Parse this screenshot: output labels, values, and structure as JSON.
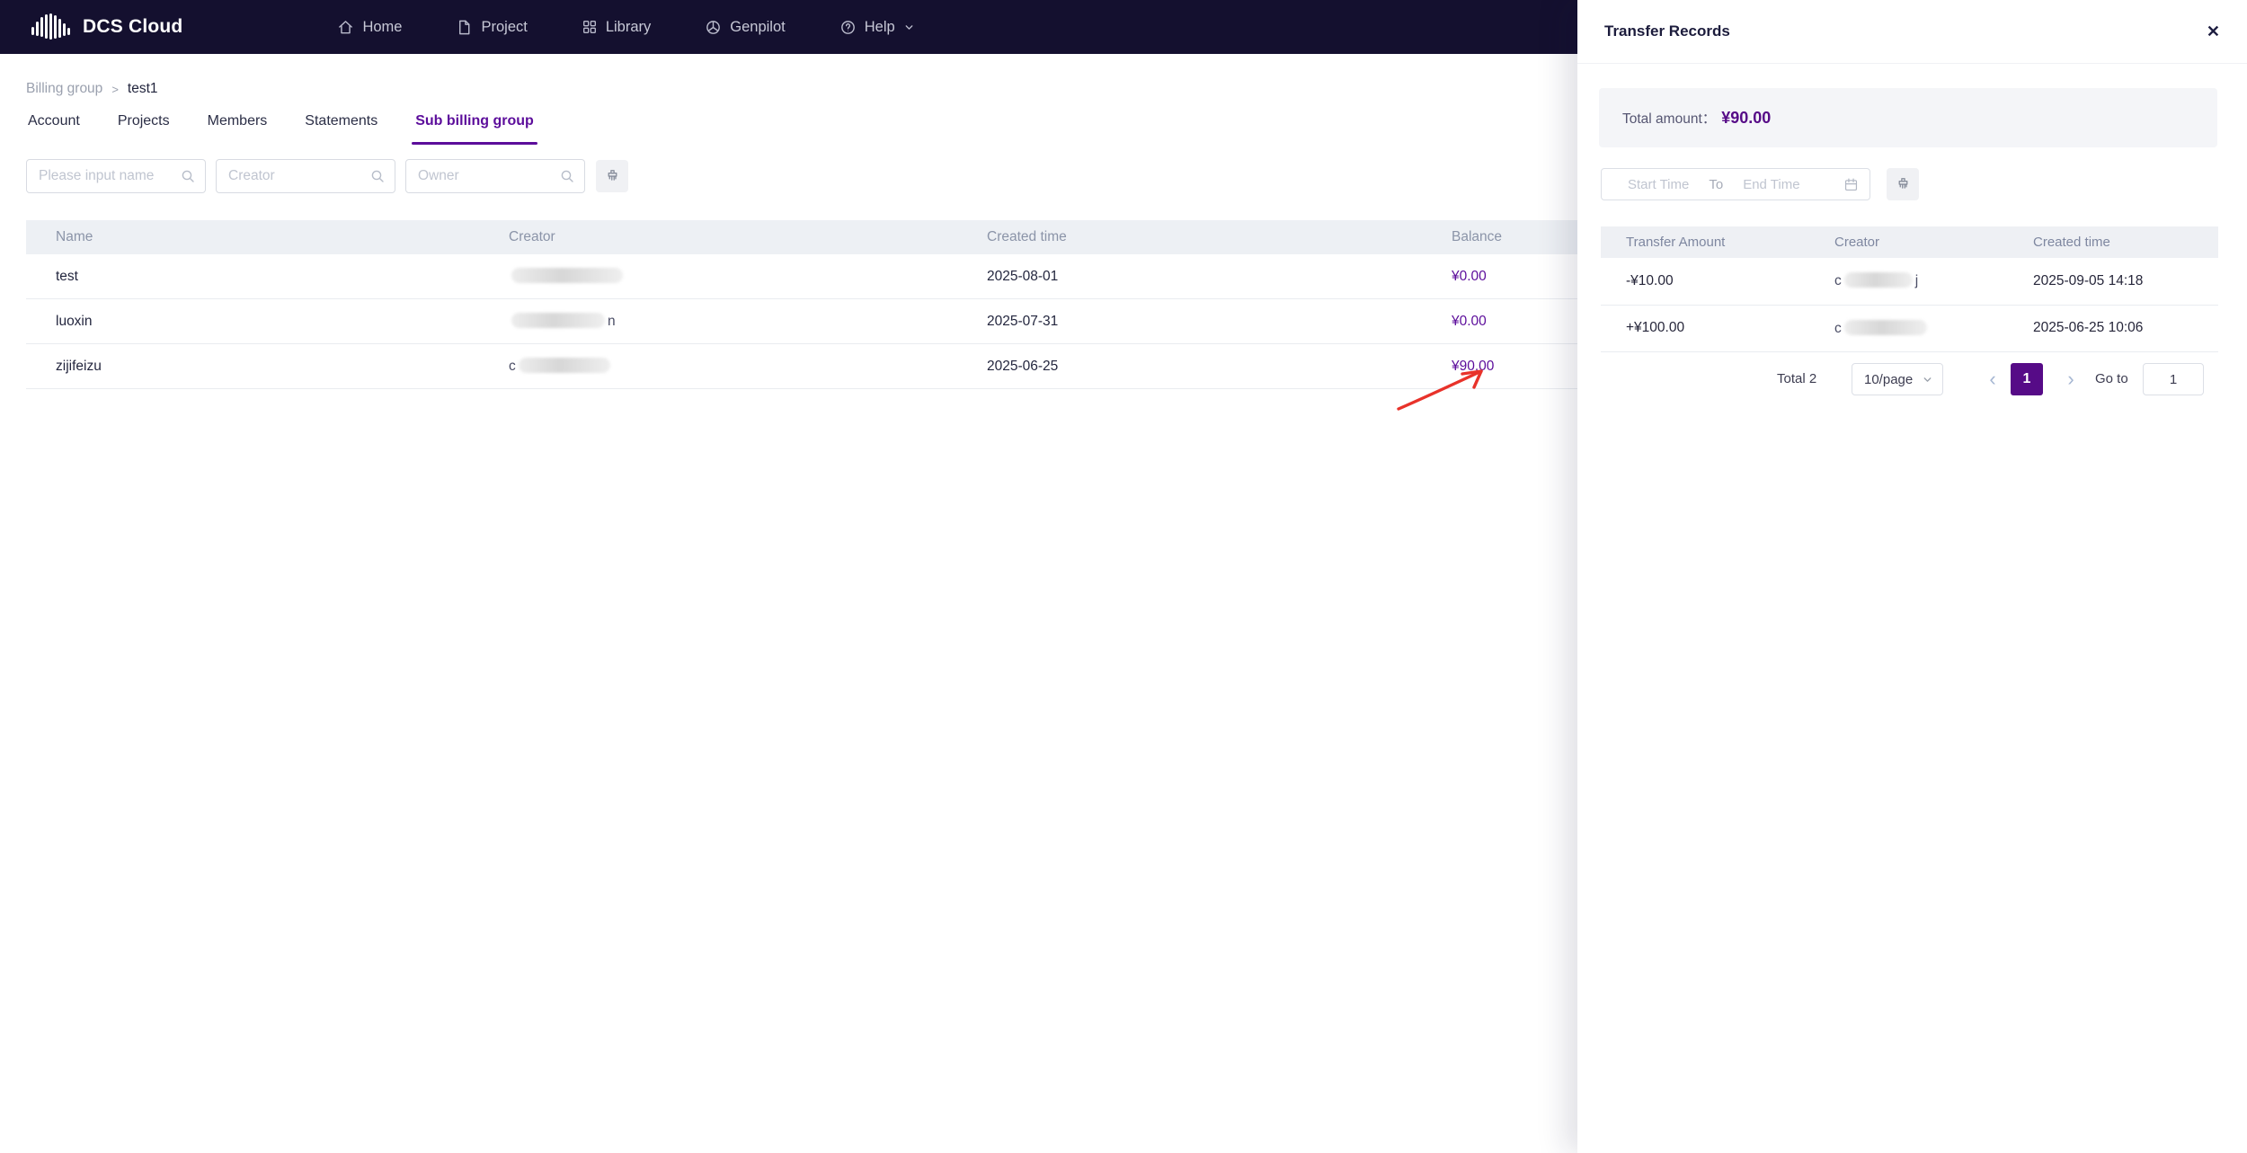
{
  "navbar": {
    "brand": "DCS Cloud",
    "items": [
      {
        "label": "Home",
        "icon": "home-icon"
      },
      {
        "label": "Project",
        "icon": "project-icon"
      },
      {
        "label": "Library",
        "icon": "library-icon"
      },
      {
        "label": "Genpilot",
        "icon": "genpilot-icon"
      },
      {
        "label": "Help",
        "icon": "help-icon",
        "has_dropdown": true
      }
    ]
  },
  "breadcrumb": {
    "parent": "Billing group",
    "separator": ">",
    "current": "test1"
  },
  "tabs": {
    "items": [
      {
        "label": "Account"
      },
      {
        "label": "Projects"
      },
      {
        "label": "Members"
      },
      {
        "label": "Statements"
      },
      {
        "label": "Sub billing group",
        "active": true
      }
    ]
  },
  "filters": {
    "name_placeholder": "Please input name",
    "creator_placeholder": "Creator",
    "owner_placeholder": "Owner"
  },
  "table": {
    "columns": {
      "name": "Name",
      "creator": "Creator",
      "created": "Created time",
      "balance": "Balance"
    },
    "rows": [
      {
        "name": "test",
        "creator_prefix": "",
        "creator_suffix": "",
        "created": "2025-08-01",
        "balance": "¥0.00"
      },
      {
        "name": "luoxin",
        "creator_prefix": "",
        "creator_suffix": "n",
        "created": "2025-07-31",
        "balance": "¥0.00"
      },
      {
        "name": "zijifeizu",
        "creator_prefix": "c",
        "creator_suffix": "",
        "created": "2025-06-25",
        "balance": "¥90.00"
      }
    ]
  },
  "drawer": {
    "title": "Transfer Records",
    "close_glyph": "✕",
    "total_label": "Total amount：",
    "total_value": "¥90.00",
    "date_filter": {
      "start": "Start Time",
      "to": "To",
      "end": "End Time"
    },
    "table": {
      "columns": {
        "amount": "Transfer Amount",
        "creator": "Creator",
        "created": "Created time"
      },
      "rows": [
        {
          "amount": "-¥10.00",
          "creator_prefix": "c",
          "creator_suffix": "j",
          "created": "2025-09-05 14:18"
        },
        {
          "amount": "+¥100.00",
          "creator_prefix": "c",
          "creator_suffix": "",
          "created": "2025-06-25 10:06"
        }
      ]
    },
    "pagination": {
      "total": "Total 2",
      "page_size": "10/page",
      "prev_glyph": "‹",
      "current_page": "1",
      "next_glyph": "›",
      "goto_label": "Go to",
      "goto_value": "1"
    }
  },
  "colors": {
    "navbar_bg": "#14102f",
    "accent_purple": "#5c0d9b",
    "pagination_active": "#560b87",
    "arrow_red": "#e8322a",
    "table_header_bg": "#edf0f4"
  }
}
